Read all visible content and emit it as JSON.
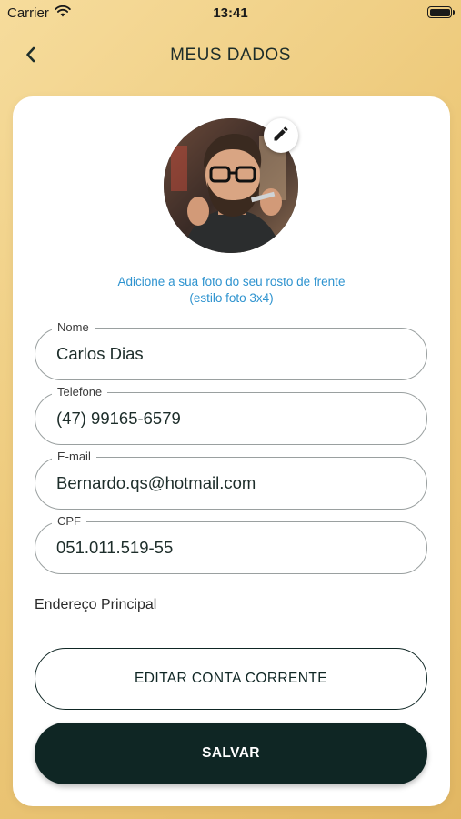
{
  "status_bar": {
    "carrier": "Carrier",
    "time": "13:41"
  },
  "header": {
    "title": "MEUS DADOS",
    "back_icon": "chevron-left-icon"
  },
  "profile": {
    "edit_icon": "pencil-icon",
    "hint_line1": "Adicione a sua foto do seu rosto de frente",
    "hint_line2": "(estilo foto 3x4)"
  },
  "form": {
    "nome": {
      "label": "Nome",
      "value": "Carlos Dias"
    },
    "telefone": {
      "label": "Telefone",
      "value": "(47) 99165-6579"
    },
    "email": {
      "label": "E-mail",
      "value": "Bernardo.qs@hotmail.com"
    },
    "cpf": {
      "label": "CPF",
      "value": "051.011.519-55"
    }
  },
  "address_label": "Endereço Principal",
  "buttons": {
    "edit_account": "EDITAR CONTA CORRENTE",
    "save": "SALVAR"
  },
  "colors": {
    "background_gradient": [
      "#f6dc9c",
      "#e2b763"
    ],
    "primary_dark": "#0f2624",
    "hint_blue": "#2e93cf"
  }
}
